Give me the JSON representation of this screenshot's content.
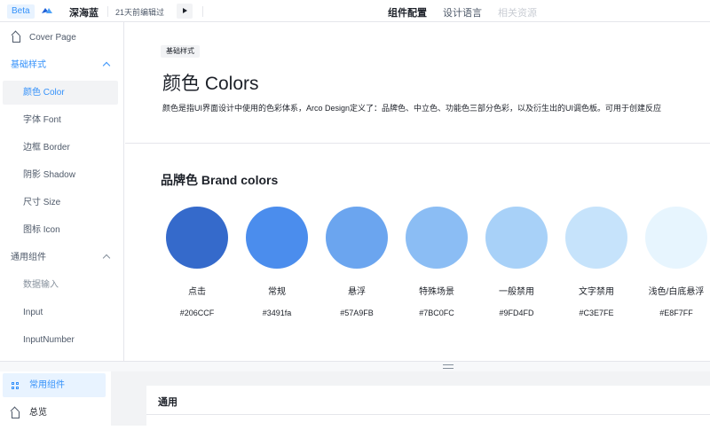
{
  "topbar": {
    "badge": "Beta",
    "brand": "深海蓝",
    "edited": "21天前编辑过",
    "tabs": [
      "组件配置",
      "设计语言",
      "相关资源"
    ]
  },
  "sidebar": {
    "cover": "Cover Page",
    "group1": "基础样式",
    "items": [
      "颜色 Color",
      "字体 Font",
      "边框 Border",
      "阴影 Shadow",
      "尺寸 Size",
      "图标 Icon"
    ],
    "group2": "通用组件",
    "items2": [
      "数据输入",
      "Input",
      "InputNumber"
    ]
  },
  "main": {
    "tag": "基础样式",
    "title": "颜色 Colors",
    "description": "颜色是指UI界面设计中使用的色彩体系，Arco Design定义了：品牌色、中立色、功能色三部分色彩，以及衍生出的UI调色板。可用于创建反应",
    "section_title": "品牌色 Brand colors",
    "swatches": [
      {
        "name": "点击",
        "hex": "#206CCF",
        "color": "#356acb"
      },
      {
        "name": "常规",
        "hex": "#3491fa",
        "color": "#4b8ded"
      },
      {
        "name": "悬浮",
        "hex": "#57A9FB",
        "color": "#6ba5ef"
      },
      {
        "name": "特殊场景",
        "hex": "#7BC0FC",
        "color": "#8bbdf4"
      },
      {
        "name": "一般禁用",
        "hex": "#9FD4FD",
        "color": "#a8d1f8"
      },
      {
        "name": "文字禁用",
        "hex": "#C3E7FE",
        "color": "#c6e3fb"
      },
      {
        "name": "浅色/白底悬浮",
        "hex": "#E8F7FF",
        "color": "#e7f5fe"
      }
    ]
  },
  "bottom": {
    "items": [
      "常用组件",
      "总览"
    ],
    "card_title": "通用"
  }
}
